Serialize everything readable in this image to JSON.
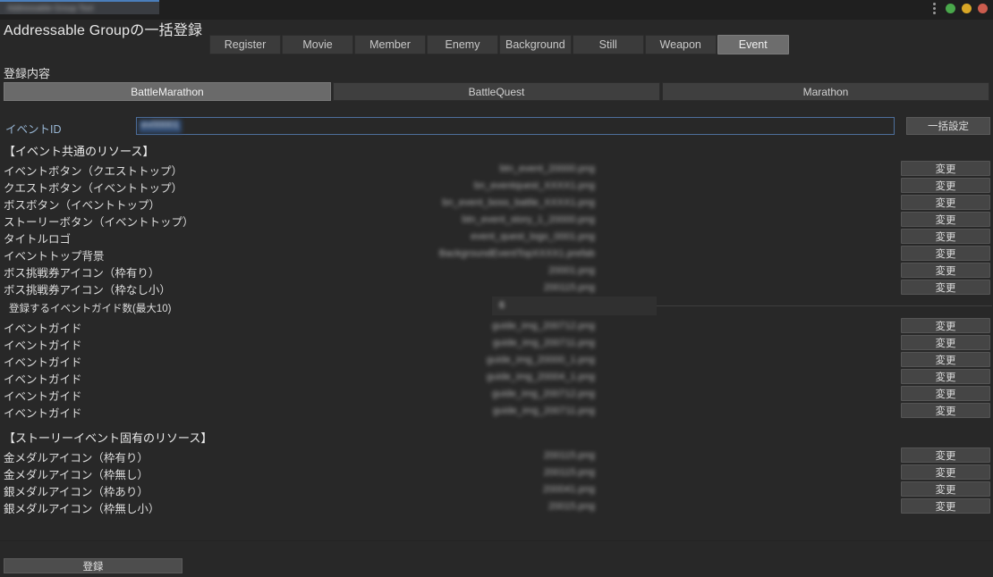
{
  "window": {
    "tab_title": "Addressable Group Tool",
    "controls": {
      "menu": "kebab-menu",
      "maximize": "green",
      "minimize": "yellow",
      "close": "red"
    }
  },
  "header": {
    "title": "Addressable Groupの一括登録"
  },
  "tabs": [
    {
      "label": "Register",
      "selected": false
    },
    {
      "label": "Movie",
      "selected": false
    },
    {
      "label": "Member",
      "selected": false
    },
    {
      "label": "Enemy",
      "selected": false
    },
    {
      "label": "Background",
      "selected": false
    },
    {
      "label": "Still",
      "selected": false
    },
    {
      "label": "Weapon",
      "selected": false
    },
    {
      "label": "Event",
      "selected": true
    }
  ],
  "section": {
    "label": "登録内容"
  },
  "subtabs": [
    {
      "label": "BattleMarathon",
      "selected": true
    },
    {
      "label": "BattleQuest",
      "selected": false
    },
    {
      "label": "Marathon",
      "selected": false
    }
  ],
  "event_id": {
    "label": "イベントID",
    "value": "ev00001",
    "batch_button": "一括設定"
  },
  "groups": [
    {
      "heading": "【イベント共通のリソース】",
      "rows": [
        {
          "label": "イベントボタン（クエストトップ）",
          "file": "btn_event_20000.png",
          "button": "変更"
        },
        {
          "label": "クエストボタン（イベントトップ）",
          "file": "bn_eventquest_XXXX1.png",
          "button": "変更"
        },
        {
          "label": "ボスボタン（イベントトップ）",
          "file": "bn_event_boss_battle_XXXX1.png",
          "button": "変更"
        },
        {
          "label": "ストーリーボタン（イベントトップ）",
          "file": "btn_event_story_1_20000.png",
          "button": "変更"
        },
        {
          "label": "タイトルロゴ",
          "file": "event_quest_logo_0001.png",
          "button": "変更"
        },
        {
          "label": "イベントトップ背景",
          "file": "BackgroundEventTopXXXX1.prefab",
          "button": "変更"
        },
        {
          "label": "ボス挑戦券アイコン（枠有り）",
          "file": "20001.png",
          "button": "変更"
        },
        {
          "label": "ボス挑戦券アイコン（枠なし小）",
          "file": "200115.png",
          "button": "変更"
        }
      ]
    }
  ],
  "guide_count": {
    "label": "登録するイベントガイド数(最大10)",
    "value": "6"
  },
  "guide_rows": [
    {
      "label": "イベントガイド",
      "file": "guide_img_200712.png",
      "button": "変更"
    },
    {
      "label": "イベントガイド",
      "file": "guide_img_200711.png",
      "button": "変更"
    },
    {
      "label": "イベントガイド",
      "file": "guide_img_20000_1.png",
      "button": "変更"
    },
    {
      "label": "イベントガイド",
      "file": "guide_img_20004_1.png",
      "button": "変更"
    },
    {
      "label": "イベントガイド",
      "file": "guide_img_200712.png",
      "button": "変更"
    },
    {
      "label": "イベントガイド",
      "file": "guide_img_200711.png",
      "button": "変更"
    }
  ],
  "story_group": {
    "heading": "【ストーリーイベント固有のリソース】",
    "rows": [
      {
        "label": "金メダルアイコン（枠有り）",
        "file": "200115.png",
        "button": "変更"
      },
      {
        "label": "金メダルアイコン（枠無し）",
        "file": "200115.png",
        "button": "変更"
      },
      {
        "label": "銀メダルアイコン（枠あり）",
        "file": "200041.png",
        "button": "変更"
      },
      {
        "label": "銀メダルアイコン（枠無し小）",
        "file": "20015.png",
        "button": "変更"
      }
    ]
  },
  "footer": {
    "submit_label": "登録"
  },
  "colors": {
    "background": "#282828",
    "titlebar": "#1f1f1f",
    "accent": "#4a7ebb",
    "tab_selected": "#6d6d6d",
    "button": "#454545",
    "label_blue": "#98b6d4"
  }
}
